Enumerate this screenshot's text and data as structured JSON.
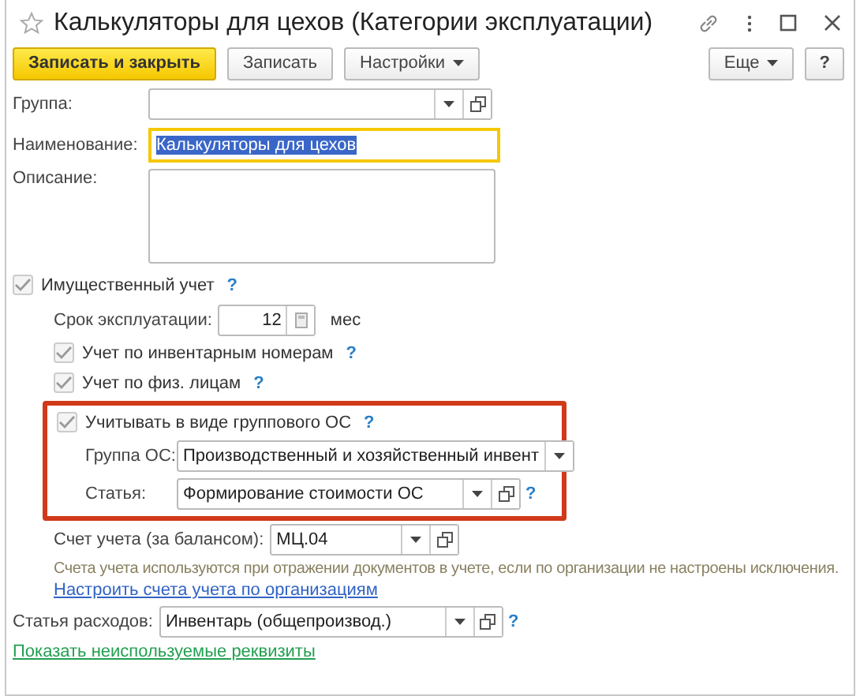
{
  "window": {
    "title": "Калькуляторы для цехов (Категории эксплуатации)"
  },
  "toolbar": [
    {
      "label": "Записать и закрыть",
      "kind": "primary"
    },
    {
      "label": "Записать",
      "kind": "plain"
    },
    {
      "label": "Настройки",
      "kind": "menu"
    }
  ],
  "toolbar_right": [
    {
      "label": "Еще",
      "kind": "menu"
    },
    {
      "label": "?",
      "kind": "plain"
    }
  ],
  "group": {
    "label": "Группа:",
    "dropdown": true,
    "open_button": true
  },
  "name": {
    "label": "Наименование:",
    "value": "Калькуляторы для цехов",
    "focused": true,
    "text_selected": true
  },
  "description": {
    "label": "Описание:"
  },
  "property": {
    "label": "Имущественный учет",
    "checked": true,
    "help": "?"
  },
  "life": {
    "label": "Срок эксплуатации:",
    "value": "12",
    "unit": "мес"
  },
  "sub_checks": [
    {
      "label": "Учет по инвентарным номерам",
      "checked": true,
      "help": "?"
    },
    {
      "label": "Учет по физ. лицам",
      "checked": true,
      "help": "?"
    }
  ],
  "group_os": {
    "highlighted": true,
    "check": {
      "label": "Учитывать в виде группового ОС",
      "checked": true,
      "help": "?"
    },
    "fields": [
      {
        "label": "Группа ОС:",
        "value": "Производственный и хозяйственный инвент",
        "dropdown": true,
        "open_button": false
      },
      {
        "label": "Статья:",
        "value": "Формирование стоимости ОС",
        "dropdown": true,
        "open_button": true,
        "help": "?"
      }
    ]
  },
  "account": {
    "label": "Счет учета (за балансом):",
    "value": "МЦ.04",
    "dropdown": true,
    "open_button": true
  },
  "note": "Счета учета используются при отражении документов в учете, если по организации не настроены исключения.",
  "setup_link": "Настроить счета учета по организациям",
  "expense": {
    "label": "Статья расходов:",
    "value": "Инвентарь (общепроизвод.)",
    "dropdown": true,
    "open_button": true,
    "help": "?"
  },
  "show_unused_link": "Показать неиспользуемые реквизиты"
}
